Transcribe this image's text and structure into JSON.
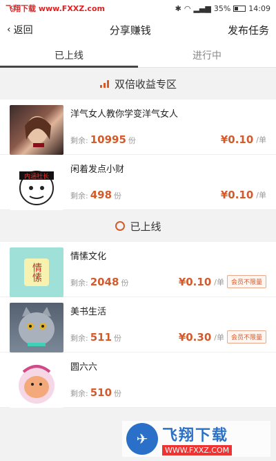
{
  "statusbar": {
    "watermark": "飞翔下载",
    "site": "www.FXXZ.com",
    "battery": "35%",
    "time": "14:09"
  },
  "nav": {
    "back": "返回",
    "title": "分享赚钱",
    "action": "发布任务"
  },
  "tabs": [
    {
      "label": "已上线"
    },
    {
      "label": "进行中"
    }
  ],
  "sections": {
    "double": "双倍收益专区",
    "online": "已上线"
  },
  "double_items": [
    {
      "title": "洋气女人教你学变洋气女人",
      "remain_label": "剩余:",
      "remain": "10995",
      "unit": "份",
      "price": "¥0.10",
      "price_unit": "/单"
    },
    {
      "title": "闲着发点小财",
      "remain_label": "剩余:",
      "remain": "498",
      "unit": "份",
      "price": "¥0.10",
      "price_unit": "/单",
      "thumb_text": "内涵社长"
    }
  ],
  "online_items": [
    {
      "title": "情愫文化",
      "remain_label": "剩余:",
      "remain": "2048",
      "unit": "份",
      "price": "¥0.10",
      "price_unit": "/单",
      "badge": "会员不限量",
      "thumb_text": "情愫"
    },
    {
      "title": "美书生活",
      "remain_label": "剩余:",
      "remain": "511",
      "unit": "份",
      "price": "¥0.30",
      "price_unit": "/单",
      "badge": "会员不限量"
    },
    {
      "title": "圆六六",
      "remain_label": "剩余:",
      "remain": "510",
      "unit": "份"
    }
  ],
  "bottom_watermark": {
    "big": "飞翔下载",
    "small": "WWW.FXXZ.COM"
  }
}
